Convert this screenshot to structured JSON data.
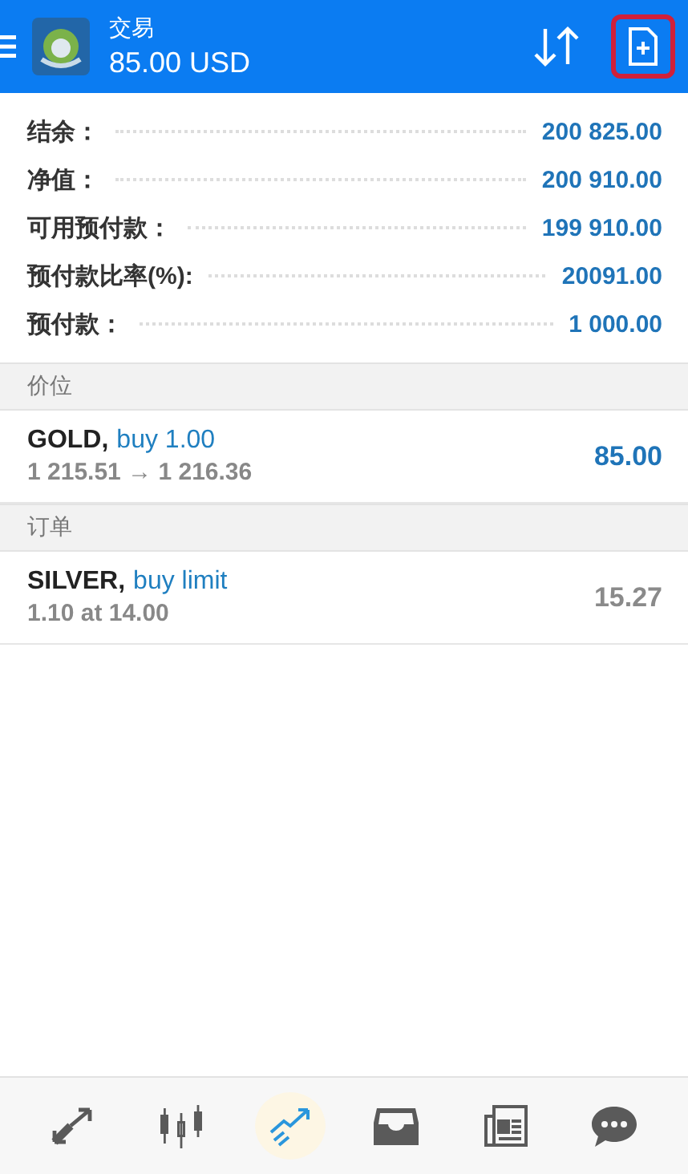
{
  "header": {
    "title": "交易",
    "balance": "85.00 USD",
    "new_order_highlighted": true
  },
  "summary": [
    {
      "label": "结余：",
      "value": "200 825.00"
    },
    {
      "label": "净值：",
      "value": "200 910.00"
    },
    {
      "label": "可用预付款：",
      "value": "199 910.00"
    },
    {
      "label": "预付款比率(%):",
      "value": "20091.00"
    },
    {
      "label": "预付款：",
      "value": "1 000.00"
    }
  ],
  "sections": [
    {
      "title": "价位",
      "items": [
        {
          "kind": "position",
          "symbol": "GOLD,",
          "action": "buy 1.00",
          "detail": "1 215.51 → 1 216.36",
          "value": "85.00"
        }
      ]
    },
    {
      "title": "订单",
      "items": [
        {
          "kind": "order",
          "symbol": "SILVER,",
          "action": "buy limit",
          "detail": "1.10 at 14.00",
          "value": "15.27"
        }
      ]
    }
  ],
  "nav": [
    {
      "kind": "quotes",
      "selected": false
    },
    {
      "kind": "chart",
      "selected": false
    },
    {
      "kind": "trade",
      "selected": true
    },
    {
      "kind": "inbox",
      "selected": false
    },
    {
      "kind": "news",
      "selected": false
    },
    {
      "kind": "chat",
      "selected": false
    }
  ]
}
